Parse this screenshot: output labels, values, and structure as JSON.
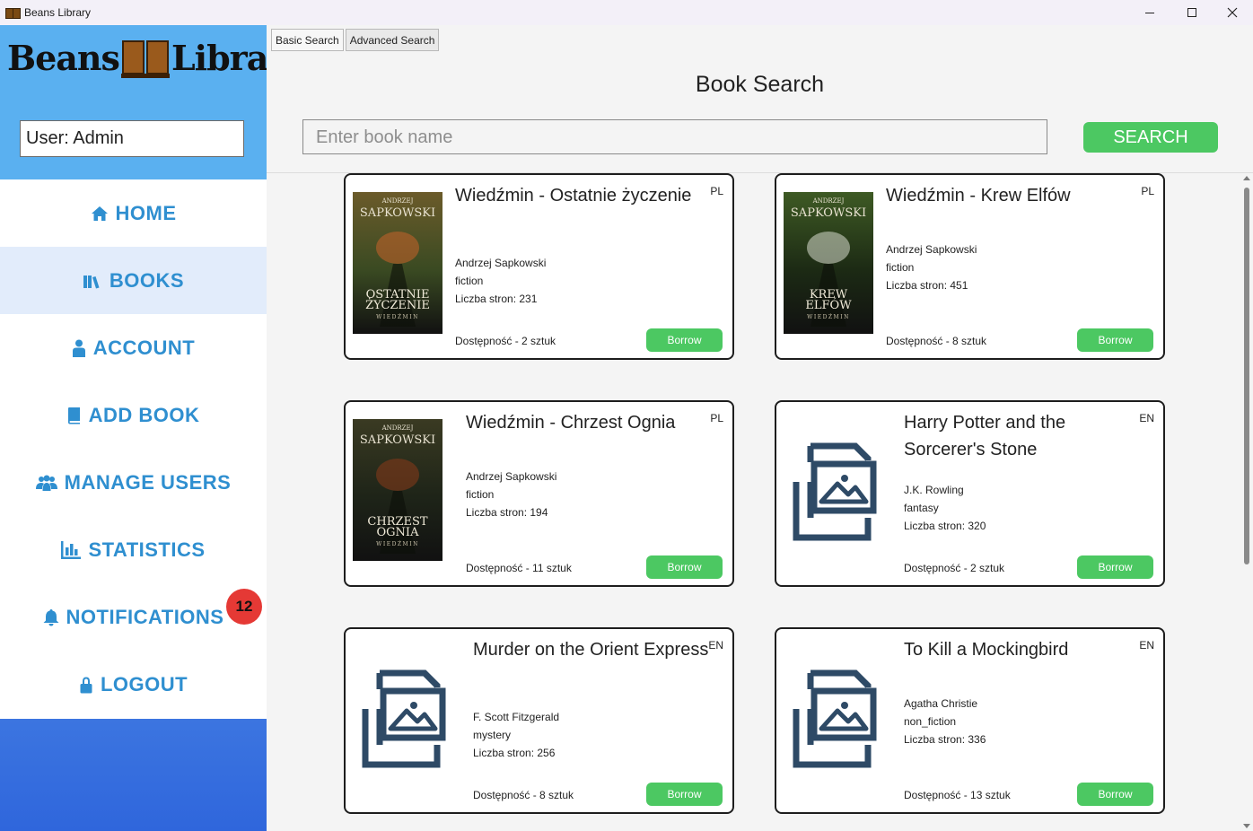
{
  "window": {
    "title": "Beans Library"
  },
  "sidebar": {
    "logo_left": "Beans",
    "logo_right": "Library",
    "user_label": "User: Admin",
    "notification_count": "12",
    "items": [
      {
        "label": "HOME",
        "icon": "home-icon",
        "active": false
      },
      {
        "label": "BOOKS",
        "icon": "books-icon",
        "active": true
      },
      {
        "label": "ACCOUNT",
        "icon": "person-icon",
        "active": false
      },
      {
        "label": "ADD BOOK",
        "icon": "book-icon",
        "active": false
      },
      {
        "label": "MANAGE USERS",
        "icon": "users-icon",
        "active": false
      },
      {
        "label": "STATISTICS",
        "icon": "chart-icon",
        "active": false
      },
      {
        "label": "NOTIFICATIONS",
        "icon": "bell-icon",
        "active": false
      },
      {
        "label": "LOGOUT",
        "icon": "lock-icon",
        "active": false
      }
    ]
  },
  "tabs": [
    {
      "label": "Basic Search",
      "active": true
    },
    {
      "label": "Advanced Search",
      "active": false
    }
  ],
  "main": {
    "title": "Book Search",
    "search_placeholder": "Enter book name",
    "search_button": "SEARCH"
  },
  "books": [
    {
      "title": "Wiedźmin - Ostatnie życzenie",
      "lang": "PL",
      "author": "Andrzej Sapkowski",
      "genre": "fiction",
      "pages": "Liczba stron: 231",
      "availability": "Dostępność - 2 sztuk",
      "borrow": "Borrow",
      "cover": {
        "type": "image",
        "top": "ANDRZEJ",
        "author": "SAPKOWSKI",
        "line1": "OSTATNIE",
        "line2": "ŻYCZENIE",
        "series": "WIEDŹMIN",
        "colors": [
          "#3a4a22",
          "#6b5b2a",
          "#c8632a"
        ]
      }
    },
    {
      "title": "Wiedźmin - Krew Elfów",
      "lang": "PL",
      "author": "Andrzej Sapkowski",
      "genre": "fiction",
      "pages": "Liczba stron: 451",
      "availability": "Dostępność - 8 sztuk",
      "borrow": "Borrow",
      "cover": {
        "type": "image",
        "top": "ANDRZEJ",
        "author": "SAPKOWSKI",
        "line1": "KREW",
        "line2": "ELFÓW",
        "series": "WIEDŹMIN",
        "colors": [
          "#1c2a14",
          "#3e5a24",
          "#d8dcd0"
        ]
      }
    },
    {
      "title": "Wiedźmin - Chrzest Ognia",
      "lang": "PL",
      "author": "Andrzej Sapkowski",
      "genre": "fiction",
      "pages": "Liczba stron: 194",
      "availability": "Dostępność - 11 sztuk",
      "borrow": "Borrow",
      "cover": {
        "type": "image",
        "top": "ANDRZEJ",
        "author": "SAPKOWSKI",
        "line1": "CHRZEST",
        "line2": "OGNIA",
        "series": "WIEDŹMIN",
        "colors": [
          "#1e2418",
          "#3a3a22",
          "#8a3a1a"
        ]
      }
    },
    {
      "title": "Harry Potter and the Sorcerer's Stone",
      "lang": "EN",
      "author": "J.K. Rowling",
      "genre": "fantasy",
      "pages": "Liczba stron: 320",
      "availability": "Dostępność - 2 sztuk",
      "borrow": "Borrow",
      "cover": {
        "type": "placeholder"
      }
    },
    {
      "title": "Murder on the Orient Express",
      "lang": "EN",
      "author": "F. Scott Fitzgerald",
      "genre": "mystery",
      "pages": "Liczba stron: 256",
      "availability": "Dostępność - 8 sztuk",
      "borrow": "Borrow",
      "cover": {
        "type": "placeholder"
      }
    },
    {
      "title": "To Kill a Mockingbird",
      "lang": "EN",
      "author": "Agatha Christie",
      "genre": "non_fiction",
      "pages": "Liczba stron: 336",
      "availability": "Dostępność - 13 sztuk",
      "borrow": "Borrow",
      "cover": {
        "type": "placeholder"
      }
    }
  ],
  "colors": {
    "sidebar_header": "#5ab0f0",
    "nav_text": "#2f8fd0",
    "nav_active_bg": "#e2ecfb",
    "sidebar_footer": "#2f66dc",
    "accent_green": "#4cc862",
    "badge_red": "#e53935",
    "placeholder_icon": "#2e4a66"
  }
}
